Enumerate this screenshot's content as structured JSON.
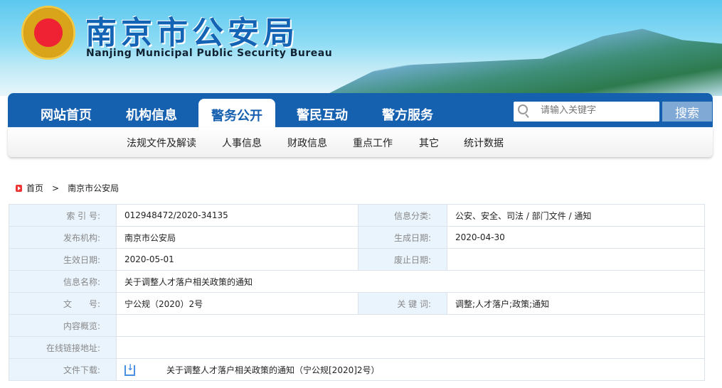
{
  "header": {
    "title": "南京市公安局",
    "subtitle": "Nanjing Municipal Public Security Bureau"
  },
  "nav": {
    "items": [
      "网站首页",
      "机构信息",
      "警务公开",
      "警民互动",
      "警方服务"
    ],
    "active": 2
  },
  "search": {
    "placeholder": "请输入关键字",
    "button": "搜索"
  },
  "subnav": [
    "法规文件及解读",
    "人事信息",
    "财政信息",
    "重点工作",
    "其它",
    "统计数据"
  ],
  "breadcrumb": {
    "home": "首页",
    "sep": ">",
    "current": "南京市公安局"
  },
  "info": {
    "index_label": "索 引 号:",
    "index_value": "012948472/2020-34135",
    "category_label": "信息分类:",
    "category_value": "公安、安全、司法 / 部门文件 / 通知",
    "publisher_label": "发布机构:",
    "publisher_value": "南京市公安局",
    "created_label": "生成日期:",
    "created_value": "2020-04-30",
    "effective_label": "生效日期:",
    "effective_value": "2020-05-01",
    "abolished_label": "废止日期:",
    "abolished_value": "",
    "name_label": "信息名称:",
    "name_value": "关于调整人才落户相关政策的通知",
    "docno_label": "文　　号:",
    "docno_value": "宁公规（2020）2号",
    "keywords_label": "关 键 词:",
    "keywords_value": "调整;人才落户;政策;通知",
    "summary_label": "内容概览:",
    "summary_value": "",
    "link_label": "在线链接地址:",
    "link_value": "",
    "download_label": "文件下载:",
    "download_value": "关于调整人才落户相关政策的通知（宁公规[2020]2号）"
  }
}
